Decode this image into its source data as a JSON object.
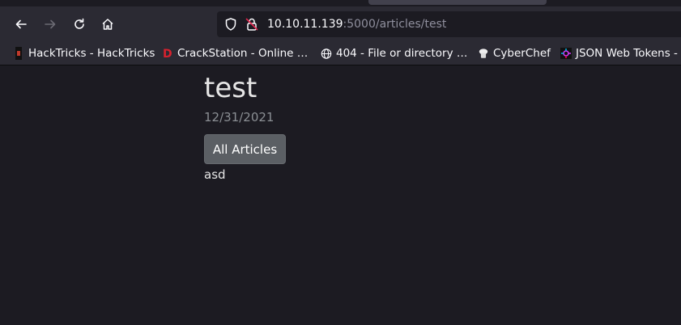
{
  "browser": {
    "url_host": "10.10.11.139",
    "url_rest": ":5000/articles/test",
    "bookmarks": [
      {
        "label": "HackTricks - HackTricks",
        "icon": "hacktricks-icon"
      },
      {
        "label": "CrackStation - Online …",
        "icon": "crackstation-icon"
      },
      {
        "label": "404 - File or directory …",
        "icon": "globe-icon"
      },
      {
        "label": "CyberChef",
        "icon": "cyberchef-icon"
      },
      {
        "label": "JSON Web Tokens -",
        "icon": "jwt-icon"
      }
    ]
  },
  "article": {
    "title": "test",
    "date": "12/31/2021",
    "all_articles_label": "All Articles",
    "body": "asd"
  },
  "colors": {
    "page_bg": "#1c1b22",
    "toolbar_bg": "#2b2a33",
    "button_bg": "#5b5f64"
  }
}
